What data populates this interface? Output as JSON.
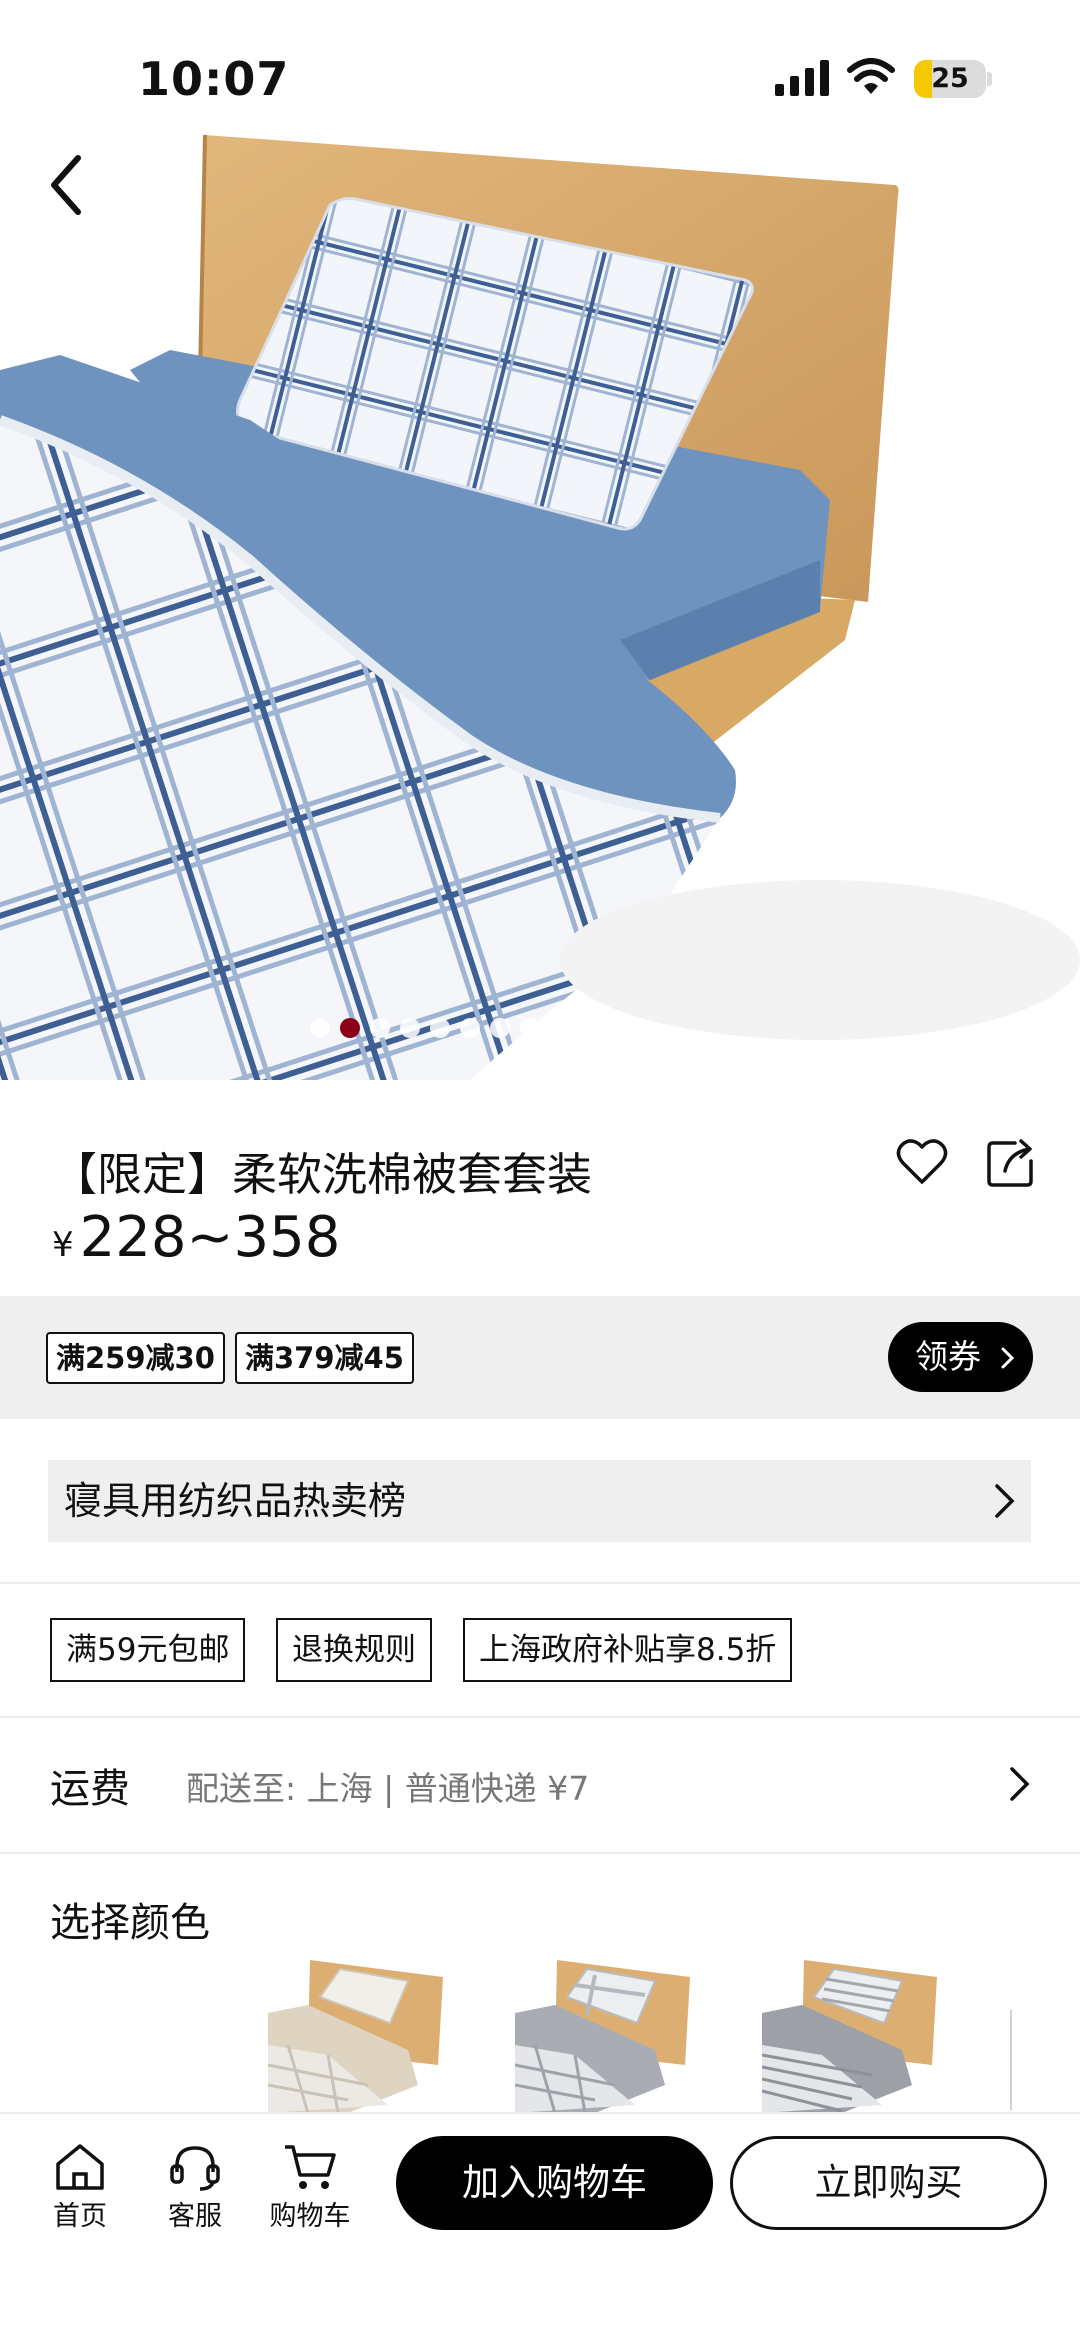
{
  "status_bar": {
    "time": "10:07",
    "battery": "25",
    "battery_level": 0.25
  },
  "product": {
    "title": "【限定】柔软洗棉被套套装",
    "currency": "¥",
    "price": "228~358",
    "image_count": 11,
    "active_image_index": 1
  },
  "promo": {
    "coupons": [
      "满259减30",
      "满379减45"
    ],
    "get_coupon_label": "领券"
  },
  "ranking": {
    "label": "寝具用纺织品热卖榜"
  },
  "service_tags": [
    "满59元包邮",
    "退换规则",
    "上海政府补贴享8.5折"
  ],
  "shipping": {
    "label": "运费",
    "detail": "配送至: 上海 | 普通快递 ¥7"
  },
  "color_section": {
    "label": "选择颜色",
    "swatches": [
      "beige-check",
      "grey-check",
      "grey-stripe"
    ]
  },
  "bottom_nav": {
    "items": [
      {
        "label": "首页",
        "icon": "home-icon"
      },
      {
        "label": "客服",
        "icon": "headset-icon"
      },
      {
        "label": "购物车",
        "icon": "cart-icon"
      }
    ],
    "add_to_cart": "加入购物车",
    "buy_now": "立即购买"
  },
  "colors": {
    "accent_dot": "#8b0016",
    "promo_bg": "#efefef",
    "bedding_blue": "#6e93bf"
  }
}
